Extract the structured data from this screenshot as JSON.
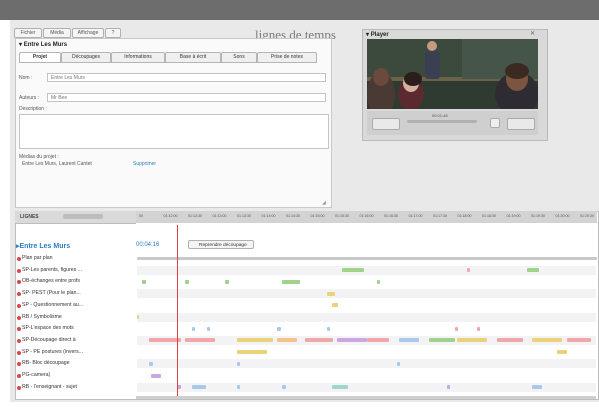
{
  "app": {
    "title": "lignes de temps",
    "menu": [
      "Fichier",
      "Média",
      "Affichage",
      "?"
    ]
  },
  "project_panel": {
    "title": "Entre Les Murs",
    "tabs": [
      "Projet",
      "Découpages",
      "Informations",
      "Base à écrit",
      "Sons",
      "Prise de notes"
    ],
    "active_tab": 0,
    "fields": {
      "nom_label": "Nom :",
      "nom_value": "Entre Les Murs",
      "auteurs_label": "Auteurs :",
      "auteurs_value": "Mr Bee",
      "description_label": "Description :"
    },
    "media_label": "Médias du projet :",
    "media_item": "Entre Les Murs, Laurent Cantet",
    "media_action": "Supprimer"
  },
  "player": {
    "title": "Player",
    "time": "00:01:48"
  },
  "timeline": {
    "header_label": "LIGNES",
    "ticks": [
      "00",
      "01:12:00",
      "01:12:30",
      "01:13:00",
      "01:13:30",
      "01:14:00",
      "01:14:30",
      "01:15:00",
      "01:15:30",
      "01:16:00",
      "01:16:30",
      "01:17:00",
      "01:17:30",
      "01:18:00",
      "01:18:30",
      "01:19:00",
      "01:19:30",
      "01:20:00",
      "01:20:30"
    ],
    "project_name": "Entre Les Murs",
    "timecode": "00:04:16",
    "resume_button": "Reprendre découpage",
    "tracks": [
      "Plan par plan",
      "SP-Les parents, figures ...",
      "OB-échanges entre profs",
      "SP- PEST (Pour le plan...",
      "SP - Questionnement au...",
      "RB / Symbolisme",
      "SP-L'espace des mots",
      "SP-Découpage direct à",
      "SP - PE postures (invers...",
      "RB- Bloc découpage",
      "PG-camera)",
      "RB - l'enseignant - sujet"
    ]
  },
  "colors": {
    "accent_blue": "#2a7fc2",
    "track_dot": "#d84848",
    "playhead": "#e04040",
    "segments": [
      "#9fd28a",
      "#f0a7a7",
      "#e9d27a",
      "#a9c8ea",
      "#c9a7e0",
      "#f2c48a",
      "#9fd8c8"
    ]
  }
}
